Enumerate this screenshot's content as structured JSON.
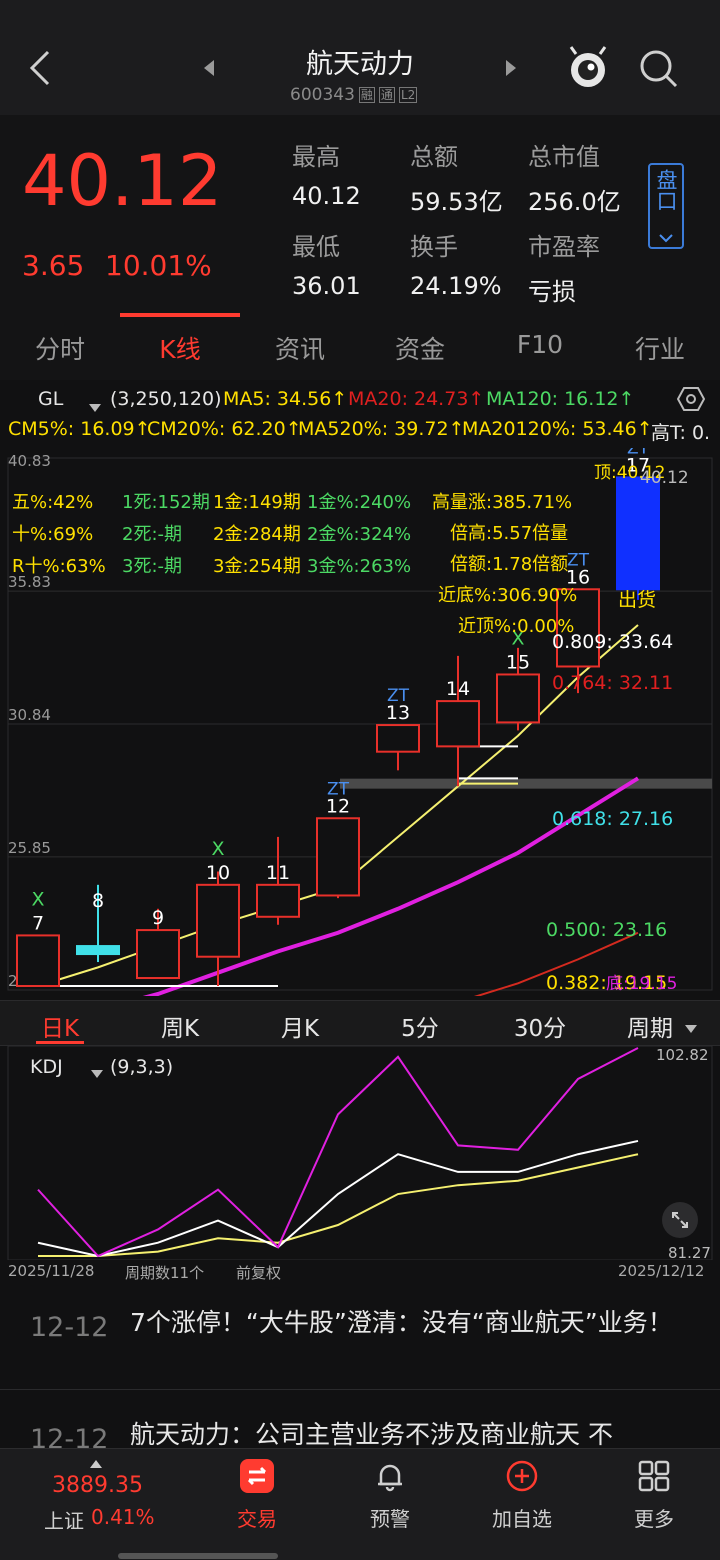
{
  "header": {
    "title": "航天动力",
    "code": "600343",
    "badges": [
      "融",
      "通",
      "L2"
    ]
  },
  "quote": {
    "price": "40.12",
    "change": "3.65",
    "change_pct": "10.01%",
    "stats": [
      {
        "label": "最高",
        "value": "40.12"
      },
      {
        "label": "总额",
        "value": "59.53亿"
      },
      {
        "label": "总市值",
        "value": "256.0亿"
      },
      {
        "label": "最低",
        "value": "36.01"
      },
      {
        "label": "换手",
        "value": "24.19%"
      },
      {
        "label": "市盈率",
        "value": "亏损"
      }
    ],
    "panel_button": "盘口"
  },
  "tabs": [
    "分时",
    "K线",
    "资讯",
    "资金",
    "F10",
    "行业"
  ],
  "indicator": {
    "name": "GL",
    "params": "(3,250,120)",
    "ma5": "MA5: 34.56↑",
    "ma20": "MA20: 24.73↑",
    "ma120": "MA120: 16.12↑",
    "cm5": "CM5%: 16.09↑",
    "cm20": "CM20%: 62.20↑",
    "ma520": "MA520%: 39.72↑",
    "ma20120": "MA20120%: 53.46↑",
    "hight": "高T: 0."
  },
  "chart_data": {
    "type": "candlestick",
    "y_ticks": [
      "40.83",
      "35.83",
      "30.84",
      "25.85",
      "20.85"
    ],
    "candles": [
      {
        "label": "7",
        "open": 21.0,
        "close": 22.9,
        "high": 22.9,
        "low": 21.0,
        "color": "red",
        "marker": "X"
      },
      {
        "label": "8",
        "open": 22.2,
        "close": 22.5,
        "high": 24.8,
        "low": 21.9,
        "color": "cyan",
        "marker": ""
      },
      {
        "label": "9",
        "open": 21.3,
        "close": 23.1,
        "high": 23.9,
        "low": 21.3,
        "color": "red",
        "marker": ""
      },
      {
        "label": "10",
        "open": 22.1,
        "close": 24.8,
        "high": 25.3,
        "low": 21.0,
        "color": "red",
        "marker": "X"
      },
      {
        "label": "11",
        "open": 23.6,
        "close": 24.8,
        "high": 26.6,
        "low": 23.3,
        "color": "red",
        "marker": ""
      },
      {
        "label": "12",
        "open": 24.4,
        "close": 27.3,
        "high": 27.3,
        "low": 24.3,
        "color": "red",
        "marker": "ZT"
      },
      {
        "label": "13",
        "open": 29.8,
        "close": 30.8,
        "high": 30.8,
        "low": 29.1,
        "color": "red",
        "marker": "ZT"
      },
      {
        "label": "14",
        "open": 30.0,
        "close": 31.7,
        "high": 33.4,
        "low": 28.5,
        "color": "red",
        "marker": ""
      },
      {
        "label": "15",
        "open": 30.9,
        "close": 32.7,
        "high": 33.7,
        "low": 30.6,
        "color": "red",
        "marker": "X"
      },
      {
        "label": "16",
        "open": 33.0,
        "close": 35.9,
        "high": 35.9,
        "low": 32.0,
        "color": "red",
        "marker": "ZT"
      },
      {
        "label": "17",
        "open": 35.9,
        "close": 40.1,
        "high": 40.1,
        "low": 35.5,
        "color": "blue",
        "marker": "ZT"
      }
    ],
    "ma5": [
      21.0,
      21.7,
      22.5,
      23.3,
      24.0,
      24.7,
      26.6,
      28.5,
      30.4,
      32.6,
      34.56
    ],
    "ma20": [
      19.6,
      20.1,
      20.7,
      21.5,
      22.3,
      23.0,
      23.9,
      24.9,
      26.0,
      27.4,
      28.8
    ],
    "ma120": [
      17.2,
      17.5,
      17.9,
      18.3,
      18.7,
      19.2,
      19.7,
      20.4,
      21.1,
      22.0,
      23.0
    ],
    "stats_left": [
      {
        "text": "五%:42%",
        "color": "#ffe000"
      },
      {
        "text": "十%:69%",
        "color": "#ffe000"
      },
      {
        "text": "R十%:63%",
        "color": "#ffe000"
      }
    ],
    "stats_mid": [
      {
        "text": "1死:152期",
        "color": "#4cd964"
      },
      {
        "text": "2死:-期",
        "color": "#4cd964"
      },
      {
        "text": "3死:-期",
        "color": "#4cd964"
      }
    ],
    "stats_gold": [
      {
        "text": "1金:149期",
        "color": "#ffe000"
      },
      {
        "text": "2金:284期",
        "color": "#ffe000"
      },
      {
        "text": "3金:254期",
        "color": "#ffe000"
      }
    ],
    "stats_goldpct": [
      {
        "text": "1金%:240%",
        "color": "#4cd964"
      },
      {
        "text": "2金%:324%",
        "color": "#4cd964"
      },
      {
        "text": "3金%:263%",
        "color": "#4cd964"
      }
    ],
    "stats_right": [
      {
        "text": "高量涨:385.71%",
        "color": "#ffe000"
      },
      {
        "text": "倍高:5.57倍量",
        "color": "#ffe000"
      },
      {
        "text": "倍额:1.78倍额",
        "color": "#ffe000"
      },
      {
        "text": "近底%:306.90%",
        "color": "#ffe000"
      },
      {
        "text": "近顶%:0.00%",
        "color": "#ffe000"
      }
    ],
    "top_label": "顶:40.12",
    "top_value": "40.12",
    "sell_label": "出货",
    "fib": [
      {
        "text": "0.809: 33.64",
        "color": "#ffffff"
      },
      {
        "text": "0.764: 32.11",
        "color": "#e02020"
      },
      {
        "text": "0.618: 27.16",
        "color": "#40e0e8"
      },
      {
        "text": "0.500: 23.16",
        "color": "#4cd964"
      },
      {
        "text": "0.382: 19.15",
        "color": "#ffe000"
      }
    ],
    "bottom_label": "底:19.15"
  },
  "periods": [
    "日K",
    "周K",
    "月K",
    "5分",
    "30分",
    "周期"
  ],
  "kdj": {
    "name": "KDJ",
    "params": "(9,3,3)",
    "top_value": "102.82",
    "bottom_value": "81.27",
    "date_start": "2025/11/28",
    "date_end": "2025/12/12",
    "period_count": "周期数11个",
    "adjust": "前复权",
    "k": [
      84,
      81,
      84,
      89,
      83,
      95,
      104,
      100,
      100,
      104,
      107
    ],
    "d": [
      81,
      81,
      82,
      85,
      84,
      88,
      95,
      97,
      98,
      101,
      104
    ],
    "j": [
      96,
      81,
      87,
      96,
      83,
      113,
      126,
      106,
      105,
      121,
      128
    ]
  },
  "news": [
    {
      "date": "12-12",
      "title": "7个涨停！“大牛股”澄清：没有“商业航天”业务！"
    },
    {
      "date": "12-12",
      "title": "航天动力：公司主营业务不涉及商业航天 不"
    }
  ],
  "bottomnav": {
    "index_value": "3889.35",
    "index_name": "上证",
    "index_pct": "0.41%",
    "items": [
      "交易",
      "预警",
      "加自选",
      "更多"
    ]
  }
}
